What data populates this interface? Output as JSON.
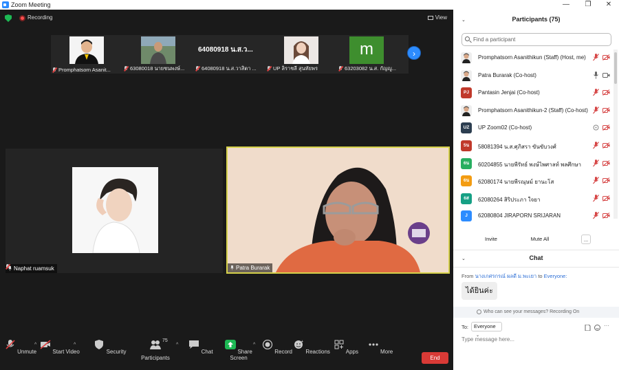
{
  "window": {
    "title": "Zoom Meeting",
    "controls": [
      "—",
      "❐",
      "✕"
    ]
  },
  "meeting": {
    "recording_label": "Recording",
    "view_label": "View",
    "thumbnails": [
      {
        "name": "Promphatsorn Asanit...",
        "type": "photo"
      },
      {
        "name": "63080018 นายชนพงษ์...",
        "type": "photo"
      },
      {
        "name": "64080918 น.ส.วาสิตา ...",
        "type": "text",
        "big_text": "64080918 น.ส.ว..."
      },
      {
        "name": "UP ลิราชลี สุนทัยพร",
        "type": "photo"
      },
      {
        "name": "63203082 น.ส. กัญญู...",
        "type": "letter",
        "letter": "m"
      }
    ],
    "tiles": [
      {
        "name": "Naphat ruamsuk"
      },
      {
        "name": "Patra Burarak"
      }
    ]
  },
  "toolbar": {
    "items": [
      {
        "label": "Unmute",
        "icon": "mic-muted-icon"
      },
      {
        "label": "Start Video",
        "icon": "video-off-icon"
      },
      {
        "label": "Security",
        "icon": "shield-icon"
      },
      {
        "label": "Participants",
        "icon": "participants-icon",
        "count": "75"
      },
      {
        "label": "Chat",
        "icon": "chat-icon"
      },
      {
        "label": "Share Screen",
        "icon": "share-screen-icon"
      },
      {
        "label": "Record",
        "icon": "record-icon"
      },
      {
        "label": "Reactions",
        "icon": "reactions-icon"
      },
      {
        "label": "Apps",
        "icon": "apps-icon"
      },
      {
        "label": "More",
        "icon": "more-icon"
      }
    ],
    "end_label": "End"
  },
  "participants_panel": {
    "title": "Participants (75)",
    "search_placeholder": "Find a participant",
    "participants": [
      {
        "name": "Promphatsorn Asanithikun (Staff) (Host, me)",
        "avatar": "",
        "avatar_type": "photo",
        "mic": "muted",
        "video": "off"
      },
      {
        "name": "Patra Burarak (Co-host)",
        "avatar": "",
        "avatar_type": "photo",
        "mic": "on",
        "video": "on"
      },
      {
        "name": "Pantasin Jenjai (Co-host)",
        "avatar": "PJ",
        "avatar_color": "#c0392b",
        "mic": "muted",
        "video": "off"
      },
      {
        "name": "Promphatsorn Asanithikun-2 (Staff) (Co-host)",
        "avatar": "",
        "avatar_type": "photo",
        "mic": "muted",
        "video": "off"
      },
      {
        "name": "UP Zoom02 (Co-host)",
        "avatar": "UZ",
        "avatar_color": "#2c3e50",
        "mic": "none",
        "video": "off"
      },
      {
        "name": "58081394 น.ส.ศุภิสรา ขันขับวงศ์",
        "avatar": "5น",
        "avatar_color": "#c0392b",
        "mic": "muted",
        "video": "off"
      },
      {
        "name": "60204855 นายพีรัทธ์ พงษ์ไพศาลท์ พลศึกษา",
        "avatar": "6น",
        "avatar_color": "#27ae60",
        "mic": "muted",
        "video": "off"
      },
      {
        "name": "62080174 นายพีรณุษม์ ยานะโส",
        "avatar": "6น",
        "avatar_color": "#f39c12",
        "mic": "muted",
        "video": "off"
      },
      {
        "name": "62080264 สิริประภา ใจยา",
        "avatar": "6ส",
        "avatar_color": "#16a085",
        "mic": "muted",
        "video": "off"
      },
      {
        "name": "62080804 JIRAPORN SRIJARAN",
        "avatar": "J",
        "avatar_color": "#2d8cff",
        "mic": "muted",
        "video": "off"
      }
    ],
    "invite_label": "Invite",
    "mute_all_label": "Mute All",
    "more_label": "..."
  },
  "chat_panel": {
    "title": "Chat",
    "from_label": "From",
    "from_name": "นางเกศรกรณ์ ผลดี ม.พะเยา",
    "to_word": "to",
    "to_name": "Everyone:",
    "message": "ได้ยินค่ะ",
    "notice": "Who can see your messages? Recording On",
    "to_label": "To:",
    "recipient": "Everyone",
    "input_placeholder": "Type message here..."
  },
  "colors": {
    "accent": "#2d8cff",
    "end_button": "#d93a36",
    "active_speaker_border": "#d6d24a",
    "share_green": "#1db954"
  }
}
